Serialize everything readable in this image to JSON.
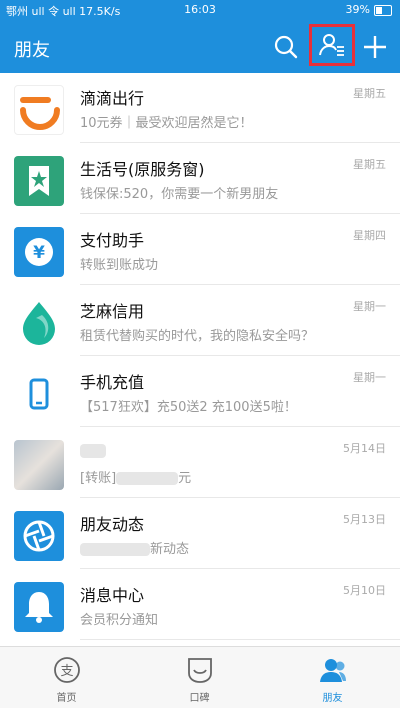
{
  "status_bar": {
    "left": "鄂州 ull 令 ull 17.5K/s",
    "time": "16:03",
    "right": "39%"
  },
  "header": {
    "title": "朋友"
  },
  "colors": {
    "brand_blue": "#1e8fdc",
    "highlight_red": "#e8303a"
  },
  "conversations": [
    {
      "name": "滴滴出行",
      "subtitle": "10元券｜最受欢迎居然是它！",
      "time": "星期五",
      "icon": "didi-icon"
    },
    {
      "name": "生活号(原服务窗)",
      "subtitle": "钱保保:520，你需要一个新男朋友",
      "time": "星期五",
      "icon": "bookmark-star-icon"
    },
    {
      "name": "支付助手",
      "subtitle": "转账到账成功",
      "time": "星期四",
      "icon": "yuan-icon"
    },
    {
      "name": "芝麻信用",
      "subtitle": "租赁代替购买的时代，我的隐私安全吗？",
      "time": "星期一",
      "icon": "sesame-drop-icon"
    },
    {
      "name": "手机充值",
      "subtitle": "【517狂欢】充50送2 充100送5啦！",
      "time": "星期一",
      "icon": "phone-icon"
    },
    {
      "name": "",
      "subtitle_prefix": "[转账]",
      "subtitle_suffix": "元",
      "time": "5月14日",
      "icon": "avatar-blurred"
    },
    {
      "name": "朋友动态",
      "subtitle_suffix": "新动态",
      "time": "5月13日",
      "icon": "shutter-icon"
    },
    {
      "name": "消息中心",
      "subtitle": "会员积分通知",
      "time": "5月10日",
      "icon": "bell-icon"
    }
  ],
  "tabs": [
    {
      "label": "首页",
      "icon": "alipay-home-icon",
      "active": false
    },
    {
      "label": "口碑",
      "icon": "koubei-icon",
      "active": false
    },
    {
      "label": "朋友",
      "icon": "friends-icon",
      "active": true
    }
  ]
}
